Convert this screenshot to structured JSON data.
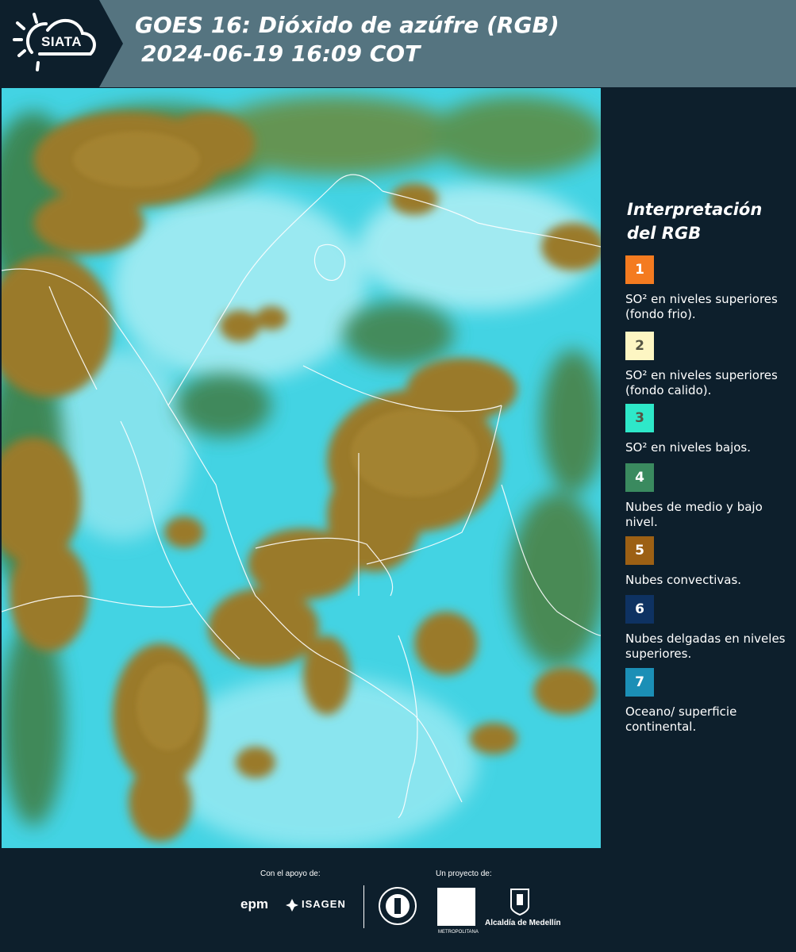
{
  "header": {
    "logo_text": "SIATA",
    "title_line1": "GOES 16: Dióxido de azúfre (RGB)",
    "title_line2": "2024-06-19 16:09 COT"
  },
  "legend": {
    "title_line1": "Interpretación",
    "title_line2": "del RGB",
    "items": [
      {
        "number": "1",
        "color": "#f47b20",
        "label": "SO² en niveles superiores (fondo frio)."
      },
      {
        "number": "2",
        "color": "#fdf6c3",
        "label": "SO² en niveles superiores (fondo calido)."
      },
      {
        "number": "3",
        "color": "#2ee8c9",
        "label": "SO² en niveles bajos."
      },
      {
        "number": "4",
        "color": "#3a8a5f",
        "label": "Nubes de medio y bajo nivel."
      },
      {
        "number": "5",
        "color": "#9c6014",
        "label": "Nubes convectivas."
      },
      {
        "number": "6",
        "color": "#0e3262",
        "label": "Nubes delgadas en niveles superiores."
      },
      {
        "number": "7",
        "color": "#1b8fb6",
        "label": "Oceano/ superficie continental."
      }
    ]
  },
  "footer": {
    "support_label": "Con el apoyo de:",
    "project_label": "Un proyecto de:",
    "epm": "epm",
    "isagen": "ISAGEN",
    "area_text": "METROPOLITANA",
    "alcaldia": "Alcaldía de Medellín"
  },
  "colors": {
    "header_bg": "#557480",
    "panel_bg": "#0d1f2c",
    "map_cyan": "#3fd6e6",
    "map_brown": "#9a7a2c",
    "map_green": "#4d7a3a"
  }
}
